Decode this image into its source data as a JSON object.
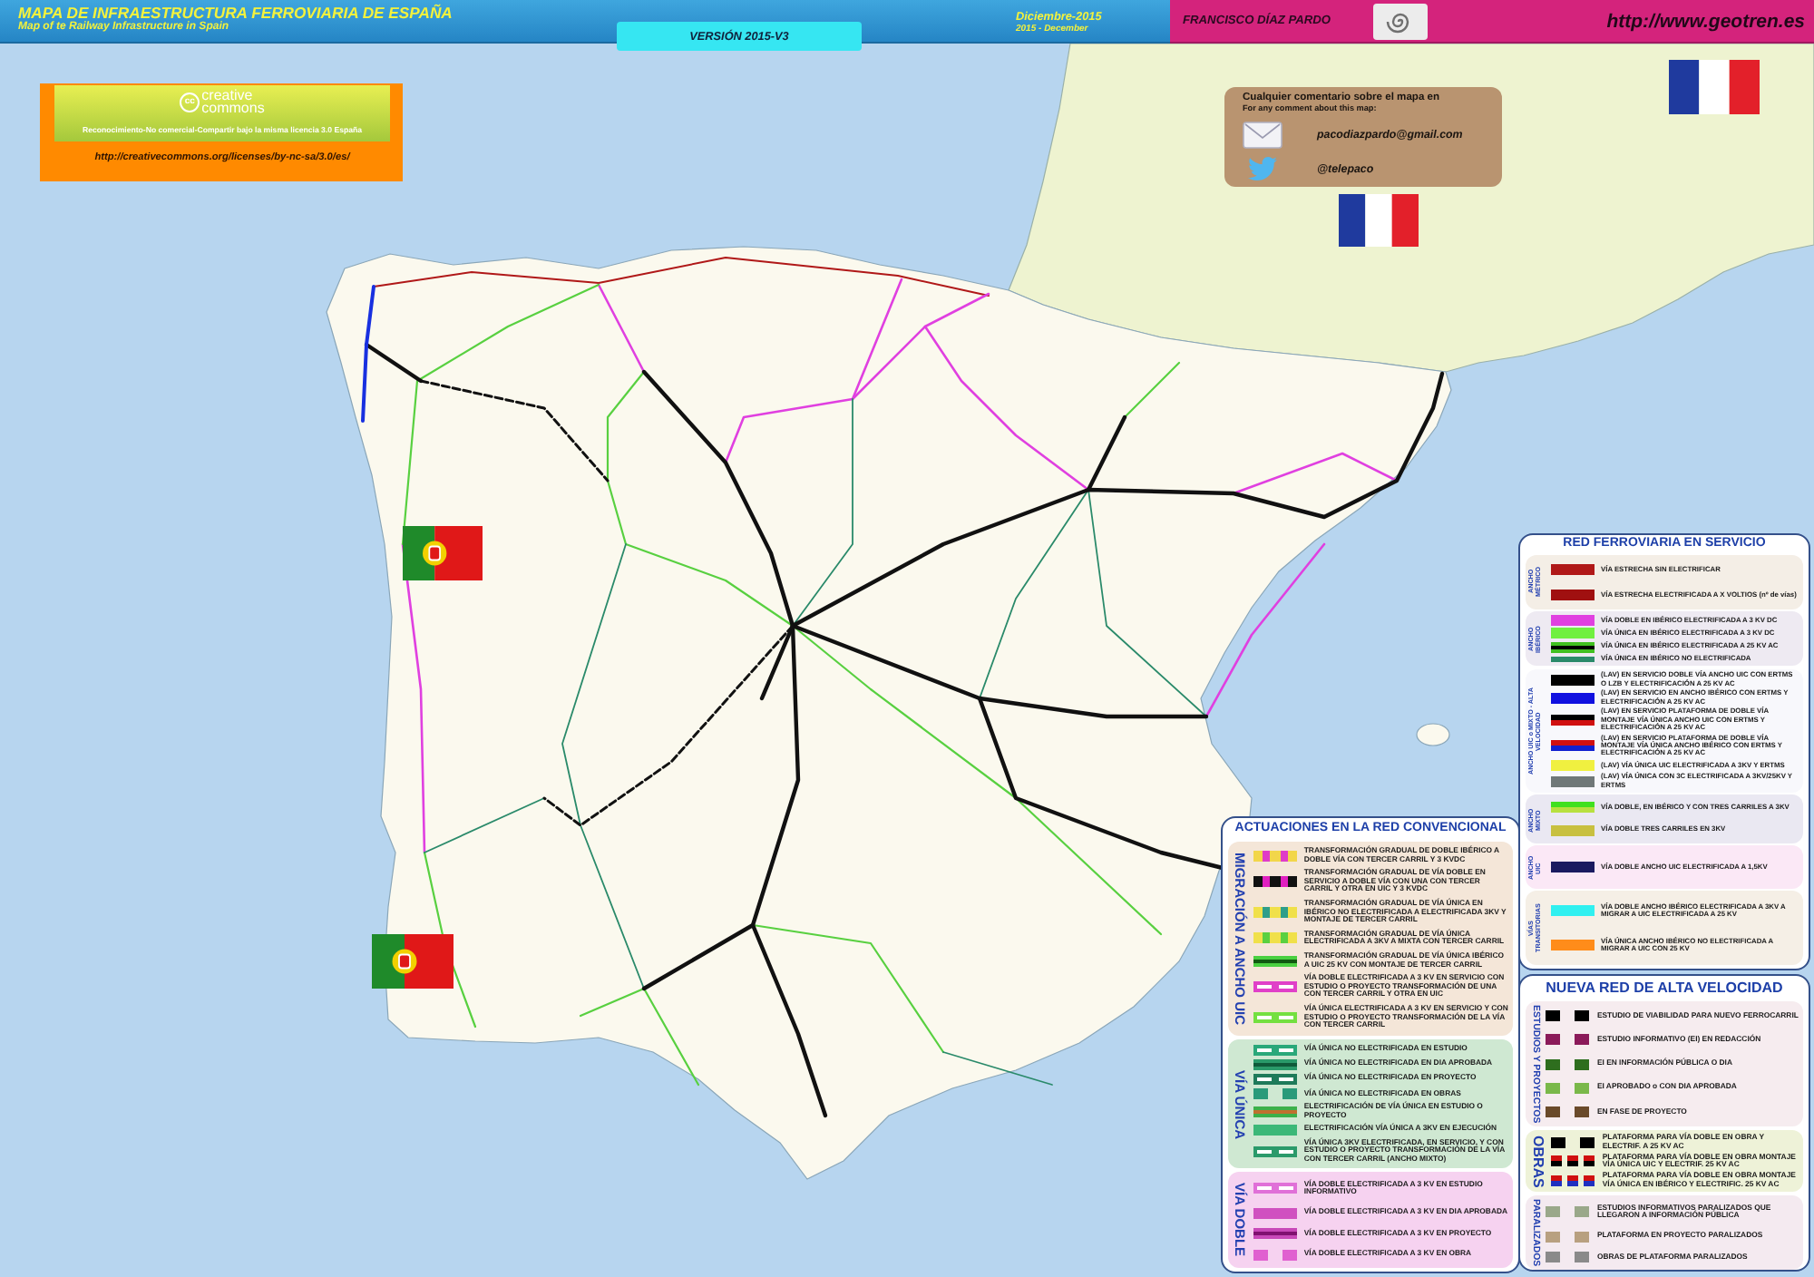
{
  "header": {
    "title": "MAPA DE INFRAESTRUCTURA FERROVIARIA DE ESPAÑA",
    "subtitle": "Map of te Railway Infrastructure in Spain",
    "version": "VERSIÓN 2015-V3",
    "date": "Diciembre-2015",
    "date_en": "2015 - December",
    "author": "FRANCISCO DÍAZ PARDO",
    "url": "http://www.geotren.es"
  },
  "license": {
    "logo_mark": "cc",
    "logo_words": [
      "creative",
      "commons"
    ],
    "text": "Reconocimiento-No comercial-Compartir bajo la misma licencia 3.0 España",
    "url": "http://creativecommons.org/licenses/by-nc-sa/3.0/es/"
  },
  "contact": {
    "heading": "Cualquier comentario sobre el mapa en",
    "subheading": "For any comment about this map:",
    "email": "pacodiazpardo@gmail.com",
    "twitter": "@telepaco"
  },
  "works_legend": {
    "title": "ACTUACIONES EN LA RED CONVENCIONAL",
    "groups": [
      {
        "label": "MIGRACIÓN A ANCHO UIC",
        "color": "#f4e6d8",
        "items": [
          {
            "kind": "dashed",
            "color": "#f2d64a",
            "accent": {
              "color": "#e03cc8"
            },
            "text": "TRANSFORMACIÓN GRADUAL DE DOBLE IBÉRICO A DOBLE VÍA CON TERCER CARRIL Y 3 KVDC"
          },
          {
            "kind": "dashed",
            "color": "#111111",
            "accent": {
              "color": "#e020c0"
            },
            "text": "TRANSFORMACIÓN GRADUAL DE VÍA DOBLE EN SERVICIO A DOBLE VÍA CON UNA CON TERCER CARRIL Y OTRA EN UIC Y 3 KVDC"
          },
          {
            "kind": "dashed",
            "color": "#f0e04a",
            "accent": {
              "color": "#2e9e8a"
            },
            "text": "TRANSFORMACIÓN GRADUAL DE VÍA ÚNICA EN IBÉRICO NO ELECTRIFICADA A ELECTRIFICADA 3KV Y MONTAJE DE TERCER CARRIL"
          },
          {
            "kind": "dashed",
            "color": "#f0e04a",
            "accent": {
              "color": "#5ad040"
            },
            "text": "TRANSFORMACIÓN GRADUAL DE VÍA ÚNICA ELECTRIFICADA A 3KV A MIXTA CON TERCER CARRIL"
          },
          {
            "kind": "lined",
            "color": "#4ad040",
            "accent": {
              "color": "#105a10"
            },
            "text": "TRANSFORMACIÓN GRADUAL DE VÍA ÚNICA IBÉRICO A UIC 25 KV CON MONTAJE DE TERCER CARRIL"
          },
          {
            "kind": "hollow",
            "color": "#e040c8",
            "text": "VÍA DOBLE ELECTRIFICADA A 3 KV EN SERVICIO CON ESTUDIO O PROYECTO TRANSFORMACIÓN DE UNA CON TERCER CARRIL Y OTRA EN UIC"
          },
          {
            "kind": "hollow",
            "color": "#74e040",
            "text": "VÍA ÚNICA ELECTRIFICADA A 3 KV EN SERVICIO Y CON ESTUDIO O PROYECTO TRANSFORMACIÓN DE LA VÍA CON TERCER CARRIL"
          }
        ]
      },
      {
        "label": "VÍA ÚNICA",
        "color": "#cfe8d2",
        "items": [
          {
            "kind": "hollow",
            "color": "#2aa87a",
            "text": "VÍA ÚNICA NO ELECTRIFICADA EN ESTUDIO"
          },
          {
            "kind": "lined",
            "color": "#2a9a6a",
            "accent": {
              "color": "#0f5a3a"
            },
            "text": "VÍA ÚNICA NO ELECTRIFICADA EN DIA APROBADA"
          },
          {
            "kind": "hollow",
            "color": "#1e7a5a",
            "text": "VÍA ÚNICA NO ELECTRIFICADA EN PROYECTO"
          },
          {
            "kind": "pair",
            "color": "#2a9a7a",
            "text": "VÍA ÚNICA NO ELECTRIFICADA EN OBRAS"
          },
          {
            "kind": "lined",
            "color": "#3cb04a",
            "accent": {
              "color": "#c07030"
            },
            "text": "ELECTRIFICACIÓN DE VÍA ÚNICA EN ESTUDIO O PROYECTO"
          },
          {
            "kind": "bar",
            "color": "#3cb878",
            "text": "ELECTRIFICACIÓN VÍA ÚNICA A 3KV EN EJECUCIÓN"
          },
          {
            "kind": "hollow",
            "color": "#2a9a6a",
            "text": "VÍA ÚNICA 3KV ELECTRIFICADA, EN SERVICIO, Y CON ESTUDIO O PROYECTO TRANSFORMACIÓN DE LA VÍA CON TERCER CARRIL (ANCHO MIXTO)"
          }
        ]
      },
      {
        "label": "VÍA DOBLE",
        "color": "#f6d2f0",
        "items": [
          {
            "kind": "hollow",
            "color": "#e070d8",
            "text": "VÍA DOBLE ELECTRIFICADA A 3 KV EN ESTUDIO INFORMATIVO"
          },
          {
            "kind": "bar",
            "color": "#d050c0",
            "text": "VÍA DOBLE ELECTRIFICADA A 3 KV EN DIA APROBADA"
          },
          {
            "kind": "lined",
            "color": "#c848b8",
            "accent": {
              "color": "#801070"
            },
            "text": "VÍA DOBLE ELECTRIFICADA A 3 KV EN PROYECTO"
          },
          {
            "kind": "pair",
            "color": "#e060d0",
            "text": "VÍA DOBLE ELECTRIFICADA A 3 KV EN OBRA"
          }
        ]
      }
    ]
  },
  "service_legend": {
    "title": "RED FERROVIARIA EN SERVICIO",
    "groups": [
      {
        "label": "ANCHO MÉTRICO",
        "color": "#f4eee6",
        "items": [
          {
            "kind": "bar",
            "color": "#b01818",
            "text": "VÍA ESTRECHA SIN ELECTRIFICAR"
          },
          {
            "kind": "bar",
            "color": "#a01010",
            "text": "VÍA ESTRECHA ELECTRIFICADA A X VOLTIOS (nº de vías)"
          }
        ]
      },
      {
        "label": "ANCHO IBÉRICO",
        "color": "#eeeaf2",
        "items": [
          {
            "kind": "bar",
            "color": "#e040e0",
            "text": "VÍA DOBLE EN IBÉRICO ELECTRIFICADA A 3 KV DC"
          },
          {
            "kind": "bar",
            "color": "#70f040",
            "text": "VÍA ÚNICA EN IBÉRICO ELECTRIFICADA A 3 KV DC"
          },
          {
            "kind": "lined",
            "color": "#40c020",
            "accent": {
              "color": "#000000"
            },
            "text": "VÍA ÚNICA EN IBÉRICO ELECTRIFICADA A 25 KV AC"
          },
          {
            "kind": "thin",
            "color": "#2a8a6a",
            "text": "VÍA ÚNICA EN IBÉRICO NO ELECTRIFICADA"
          }
        ]
      },
      {
        "label": "ANCHO UIC o MIXTO - ALTA VELOCIDAD",
        "color": "#f8f8fc",
        "items": [
          {
            "kind": "bar",
            "color": "#000000",
            "text": "(LAV) EN SERVICIO DOBLE VÍA ANCHO UIC CON ERTMS O LZB Y ELECTRIFICACIÓN A 25 KV AC"
          },
          {
            "kind": "bar",
            "color": "#1010e0",
            "text": "(LAV) EN SERVICIO EN ANCHO IBÉRICO CON ERTMS Y ELECTRIFICACIÓN A 25 KV AC"
          },
          {
            "kind": "split",
            "color": "#000000",
            "accent": {
              "color": "#d01010"
            },
            "text": "(LAV) EN SERVICIO PLATAFORMA DE DOBLE VÍA MONTAJE VÍA ÚNICA ANCHO UIC CON ERTMS Y ELECTRIFICACIÓN A 25 KV AC"
          },
          {
            "kind": "split",
            "color": "#d01010",
            "accent": {
              "color": "#1020d0"
            },
            "text": "(LAV) EN SERVICIO PLATAFORMA DE DOBLE VÍA MONTAJE VÍA ÚNICA ANCHO IBÉRICO CON ERTMS Y ELECTRIFICACIÓN A 25 KV AC"
          },
          {
            "kind": "bar",
            "color": "#f0f040",
            "text": "(LAV) VÍA ÚNICA UIC ELECTRIFICADA A 3KV Y ERTMS"
          },
          {
            "kind": "bar",
            "color": "#707878",
            "text": "(LAV) VÍA ÚNICA CON 3C ELECTRIFICADA A 3KV/25KV Y ERTMS"
          }
        ]
      },
      {
        "label": "ANCHO MIXTO",
        "color": "#eae8f2",
        "items": [
          {
            "kind": "split",
            "color": "#40e020",
            "accent": {
              "color": "#b8e040"
            },
            "text": "VÍA DOBLE, EN IBÉRICO Y CON TRES CARRILES A 3KV"
          },
          {
            "kind": "bar",
            "color": "#c8c040",
            "text": "VÍA DOBLE TRES CARRILES EN 3KV"
          }
        ]
      },
      {
        "label": "ANCHO UIC",
        "color": "#fbe8f6",
        "items": [
          {
            "kind": "bar",
            "color": "#1a1a60",
            "text": "VÍA DOBLE ANCHO UIC ELECTRIFICADA A 1,5KV"
          }
        ]
      },
      {
        "label": "VÍAS TRANSITORIAS",
        "color": "#f5efe6",
        "items": [
          {
            "kind": "bar",
            "color": "#30f0f0",
            "text": "VÍA DOBLE ANCHO IBÉRICO ELECTRIFICADA A 3KV A MIGRAR A UIC ELECTRIFICADA A 25 KV"
          },
          {
            "kind": "bar",
            "color": "#ff8c1a",
            "text": "VÍA ÚNICA ANCHO IBÉRICO NO ELECTRIFICADA A MIGRAR A UIC CON 25 KV"
          }
        ]
      }
    ]
  },
  "high_speed_legend": {
    "title": "NUEVA RED DE ALTA VELOCIDAD",
    "groups": [
      {
        "label": "ESTUDIOS Y PROYECTOS",
        "color": "#f6ecef",
        "items": [
          {
            "kind": "pair",
            "color": "#000000",
            "text": "ESTUDIO DE VIABILIDAD PARA NUEVO FERROCARRIL"
          },
          {
            "kind": "pair",
            "color": "#8b1a5a",
            "text": "ESTUDIO INFORMATIVO (EI) EN REDACCIÓN"
          },
          {
            "kind": "pair",
            "color": "#2e6e1e",
            "text": "EI EN INFORMACIÓN PÚBLICA O DIA"
          },
          {
            "kind": "pair",
            "color": "#7ab84a",
            "text": "EI APROBADO o CON DIA APROBADA"
          },
          {
            "kind": "pair",
            "color": "#6a4a2a",
            "text": "EN FASE DE PROYECTO"
          }
        ]
      },
      {
        "label": "OBRAS",
        "color": "#eef2d8",
        "items": [
          {
            "kind": "pair",
            "color": "#000000",
            "text": "PLATAFORMA PARA VÍA DOBLE EN OBRA Y ELECTRIF. A 25 KV AC"
          },
          {
            "kind": "triple",
            "color": "#d01010",
            "accent": {
              "color": "#000000"
            },
            "text": "PLATAFORMA PARA VÍA DOBLE EN OBRA MONTAJE VÍA ÚNICA UIC Y ELECTRIF. 25 KV AC"
          },
          {
            "kind": "triple",
            "color": "#d01010",
            "accent": {
              "color": "#2030c0"
            },
            "text": "PLATAFORMA PARA VÍA DOBLE EN OBRA MONTAJE VÍA ÚNICA EN IBÉRICO Y ELECTRIFIC. 25 KV AC"
          }
        ]
      },
      {
        "label": "PARALIZADOS",
        "color": "#f4eaf0",
        "items": [
          {
            "kind": "pair",
            "color": "#9aa88a",
            "text": "ESTUDIOS INFORMATIVOS PARALIZADOS QUE LLEGARON A INFORMACIÓN PÚBLICA"
          },
          {
            "kind": "pair",
            "color": "#b8a080",
            "text": "PLATAFORMA EN PROYECTO PARALIZADOS"
          },
          {
            "kind": "pair",
            "color": "#8a8a8a",
            "text": "OBRAS DE PLATAFORMA PARALIZADOS"
          }
        ]
      }
    ]
  }
}
